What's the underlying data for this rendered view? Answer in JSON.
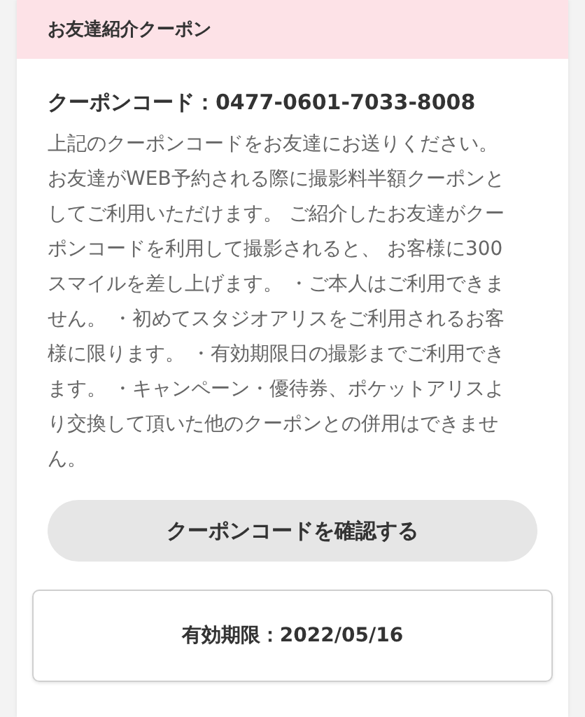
{
  "card": {
    "title": "お友達紹介クーポン",
    "code": "クーポンコード：0477-0601-7033-8008",
    "description": [
      "上記のクーポンコードをお友達にお送りください。",
      "お友達がWEB予約される際に撮影料半額クーポンとしてご利用いただけます。 ご紹介したお友達がクーポンコードを利用して撮影されると、 お客様に300スマイルを差し上げます。 ・ご本人はご利用できません。 ・初めてスタジオアリスをご利用されるお客様に限ります。 ・有効期限日の撮影までご利用できます。 ・キャンペーン・優待券、ポケットアリスより交換して頂いた他のクーポンとの併用はできません。"
    ],
    "button": "クーポンコードを確認する",
    "expiry": "有効期限：2022/05/16"
  }
}
